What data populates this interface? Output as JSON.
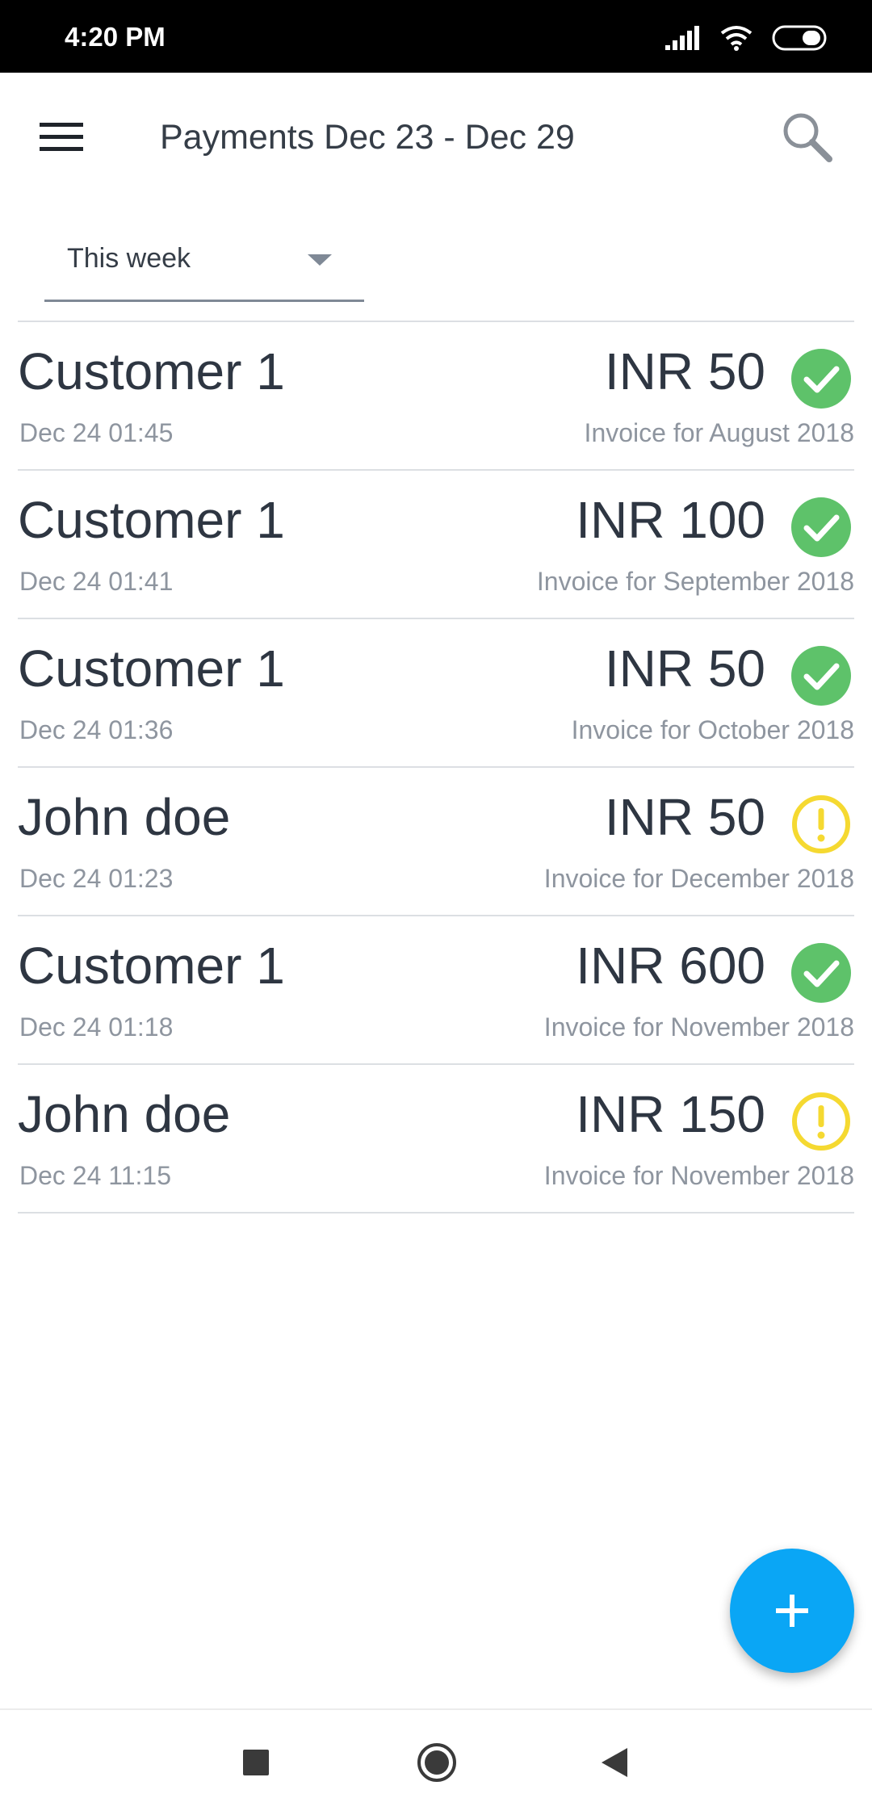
{
  "status_bar": {
    "time": "4:20 PM"
  },
  "header": {
    "title": "Payments Dec 23 - Dec 29"
  },
  "filter": {
    "selected": "This week"
  },
  "colors": {
    "paid": "#5ec26a",
    "pending": "#f5d931",
    "fab": "#0aa6f5"
  },
  "payments": [
    {
      "customer": "Customer 1",
      "date": "Dec 24 01:45",
      "amount": "INR 50",
      "note": "Invoice for August 2018",
      "status": "paid"
    },
    {
      "customer": "Customer 1",
      "date": "Dec 24 01:41",
      "amount": "INR 100",
      "note": "Invoice for September 2018",
      "status": "paid"
    },
    {
      "customer": "Customer 1",
      "date": "Dec 24 01:36",
      "amount": "INR 50",
      "note": "Invoice for October 2018",
      "status": "paid"
    },
    {
      "customer": "John doe",
      "date": "Dec 24 01:23",
      "amount": "INR 50",
      "note": "Invoice for December 2018",
      "status": "pending"
    },
    {
      "customer": "Customer 1",
      "date": "Dec 24 01:18",
      "amount": "INR 600",
      "note": "Invoice for November 2018",
      "status": "paid"
    },
    {
      "customer": "John doe",
      "date": "Dec 24 11:15",
      "amount": "INR 150",
      "note": "Invoice for November 2018",
      "status": "pending"
    }
  ],
  "icons": {
    "menu": "menu-icon",
    "search": "search-icon",
    "dropdown": "caret-down-icon",
    "paid": "check-circle-icon",
    "pending": "warning-circle-icon",
    "add": "plus-icon",
    "nav_recent": "square-icon",
    "nav_home": "circle-icon",
    "nav_back": "triangle-back-icon"
  }
}
